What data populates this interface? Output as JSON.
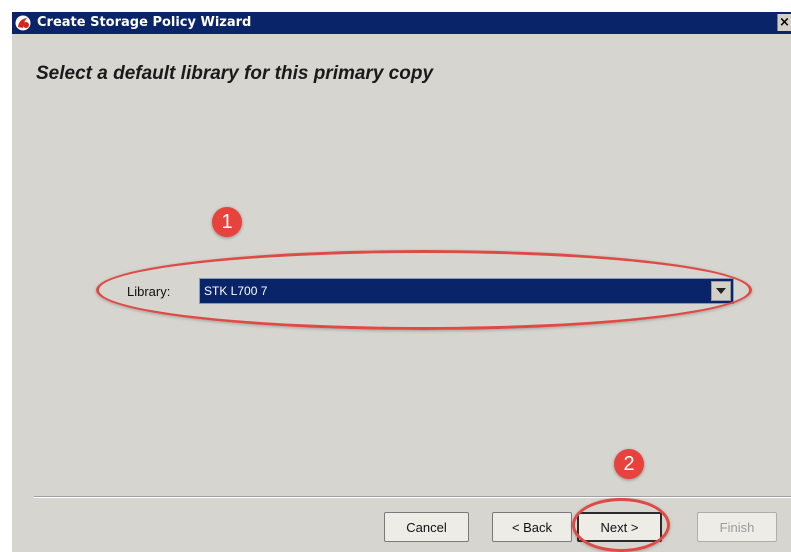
{
  "window": {
    "title": "Create Storage Policy Wizard",
    "close_glyph": "×"
  },
  "page": {
    "heading": "Select a default library for this primary copy"
  },
  "library": {
    "label": "Library:",
    "selected": "STK L700 7"
  },
  "buttons": {
    "cancel": "Cancel",
    "back": "< Back",
    "next": "Next >",
    "finish": "Finish"
  },
  "annotations": {
    "step1": "1",
    "step2": "2",
    "color": "#e8423d"
  },
  "colors": {
    "titlebar": "#0a246a",
    "dialog_bg": "#d7d5cf",
    "selection": "#0a246a"
  }
}
